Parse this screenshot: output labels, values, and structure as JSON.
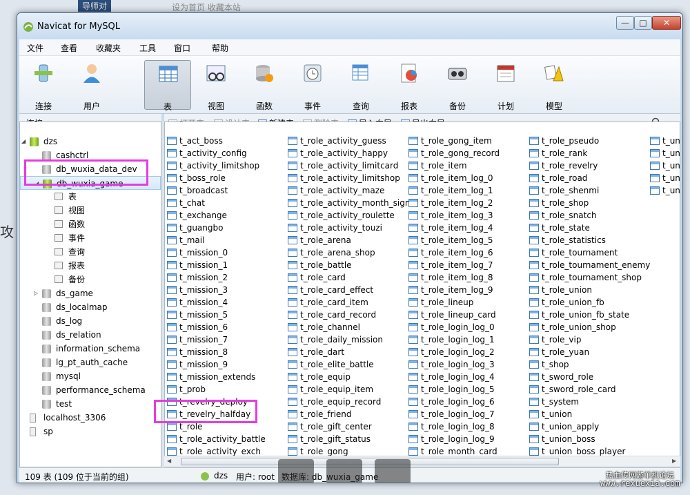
{
  "app": {
    "title": "Navicat for MySQL"
  },
  "window_controls": {
    "min": "—",
    "max": "□",
    "close": "✕"
  },
  "menu": [
    "文件",
    "查看",
    "收藏夹",
    "工具",
    "窗口",
    "帮助"
  ],
  "toolbar": {
    "connect": "连接",
    "user": "用户",
    "items": [
      {
        "label": "表",
        "icon": "table-icon",
        "active": true
      },
      {
        "label": "视图",
        "icon": "view-icon"
      },
      {
        "label": "函数",
        "icon": "function-icon"
      },
      {
        "label": "事件",
        "icon": "event-icon"
      },
      {
        "label": "查询",
        "icon": "query-icon"
      },
      {
        "label": "报表",
        "icon": "report-icon"
      },
      {
        "label": "备份",
        "icon": "backup-icon"
      },
      {
        "label": "计划",
        "icon": "schedule-icon"
      },
      {
        "label": "模型",
        "icon": "model-icon"
      }
    ]
  },
  "connection_bar": {
    "label": "连接"
  },
  "object_toolbar": {
    "open": "打开表",
    "design": "设计表",
    "new": "新建表",
    "delete": "删除表",
    "import": "导入向导",
    "export": "导出向导"
  },
  "tree": {
    "root": "dzs",
    "databases": [
      {
        "name": "cashctrl"
      },
      {
        "name": "db_wuxia_data_dev"
      },
      {
        "name": "db_wuxia_game",
        "open": true
      },
      {
        "name": "ds_game"
      },
      {
        "name": "ds_localmap"
      },
      {
        "name": "ds_log"
      },
      {
        "name": "ds_relation"
      },
      {
        "name": "information_schema"
      },
      {
        "name": "lg_pt_auth_cache"
      },
      {
        "name": "mysql"
      },
      {
        "name": "performance_schema"
      },
      {
        "name": "test"
      }
    ],
    "children": [
      "表",
      "视图",
      "函数",
      "事件",
      "查询",
      "报表",
      "备份"
    ],
    "other_connections": [
      "localhost_3306",
      "sp"
    ]
  },
  "tables": [
    [
      "t_act_boss",
      "t_activity_config",
      "t_activity_limitshop",
      "t_boss_role",
      "t_broadcast",
      "t_chat",
      "t_exchange",
      "t_guangbo",
      "t_mail",
      "t_mission_0",
      "t_mission_1",
      "t_mission_2",
      "t_mission_3",
      "t_mission_4",
      "t_mission_5",
      "t_mission_6",
      "t_mission_7",
      "t_mission_8",
      "t_mission_9",
      "t_mission_extends",
      "t_prob",
      "t_revelry_deploy",
      "t_revelry_halfday",
      "t_role",
      "t_role_activity_battle",
      "t_role_activity_exch"
    ],
    [
      "t_role_activity_guess",
      "t_role_activity_happy",
      "t_role_activity_limitcard",
      "t_role_activity_limitshop",
      "t_role_activity_maze",
      "t_role_activity_month_sign",
      "t_role_activity_roulette",
      "t_role_activity_touzi",
      "t_role_arena",
      "t_role_arena_shop",
      "t_role_battle",
      "t_role_card",
      "t_role_card_effect",
      "t_role_card_item",
      "t_role_card_record",
      "t_role_channel",
      "t_role_daily_mission",
      "t_role_dart",
      "t_role_elite_battle",
      "t_role_equip",
      "t_role_equip_item",
      "t_role_equip_record",
      "t_role_friend",
      "t_role_gift_center",
      "t_role_gift_status",
      "t_role_gong"
    ],
    [
      "t_role_gong_item",
      "t_role_gong_record",
      "t_role_item",
      "t_role_item_log_0",
      "t_role_item_log_1",
      "t_role_item_log_2",
      "t_role_item_log_3",
      "t_role_item_log_4",
      "t_role_item_log_5",
      "t_role_item_log_6",
      "t_role_item_log_7",
      "t_role_item_log_8",
      "t_role_item_log_9",
      "t_role_lineup",
      "t_role_lineup_card",
      "t_role_login_log_0",
      "t_role_login_log_1",
      "t_role_login_log_2",
      "t_role_login_log_3",
      "t_role_login_log_4",
      "t_role_login_log_5",
      "t_role_login_log_6",
      "t_role_login_log_7",
      "t_role_login_log_8",
      "t_role_login_log_9",
      "t_role_month_card"
    ],
    [
      "t_role_pseudo",
      "t_role_rank",
      "t_role_revelry",
      "t_role_road",
      "t_role_shenmi",
      "t_role_shop",
      "t_role_snatch",
      "t_role_state",
      "t_role_statistics",
      "t_role_tournament",
      "t_role_tournament_enemy",
      "t_role_tournament_shop",
      "t_role_union",
      "t_role_union_fb",
      "t_role_union_fb_state",
      "t_role_union_shop",
      "t_role_vip",
      "t_role_yuan",
      "t_shop",
      "t_sword_role",
      "t_sword_role_card",
      "t_system",
      "t_union",
      "t_union_apply",
      "t_union_boss",
      "t_union_boss_player"
    ],
    [
      "t_uni",
      "t_uni",
      "t_uni",
      "t_uni",
      "t_uni"
    ]
  ],
  "status": {
    "count": "109 表 (109 位于当前的组)",
    "connection": "dzs",
    "user": "用户: root",
    "database": "数据库: db_wuxia_game"
  },
  "background_page": {
    "top_links": "设为首页  收藏本站",
    "top_left": "导师对"
  },
  "watermark": {
    "line1": "热血传网游单机论坛",
    "line2": "www.rexuexia.com"
  },
  "colors": {
    "highlight": "#e63be0",
    "active_db_icon": "#9acd32"
  }
}
